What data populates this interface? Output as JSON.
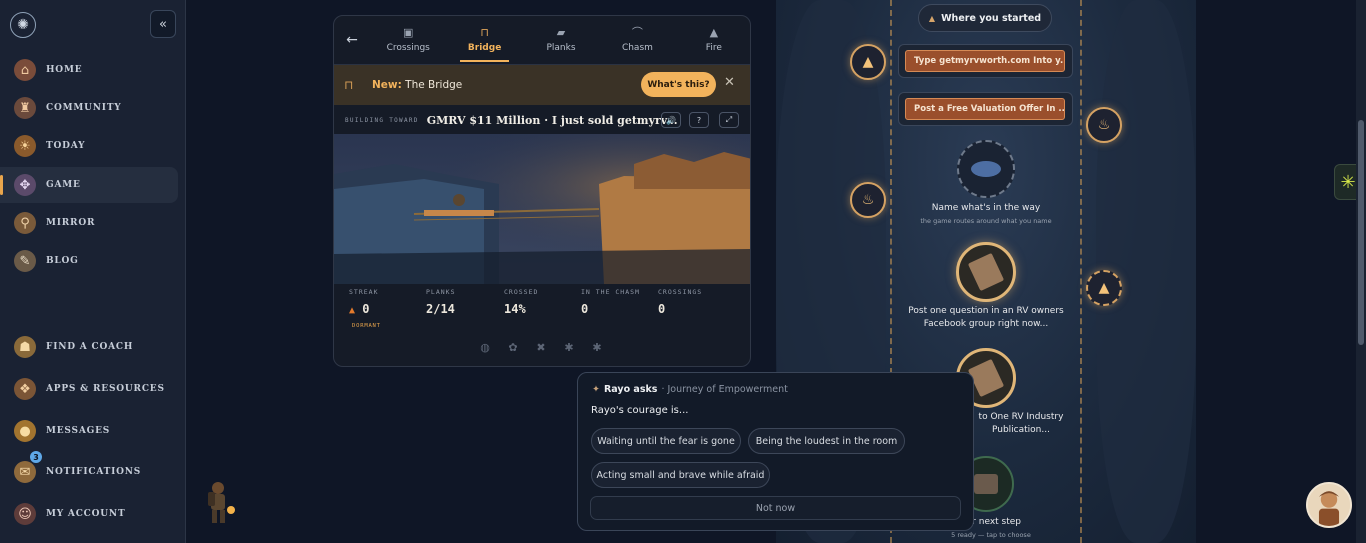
{
  "sidebar": {
    "collapse_icon": "«",
    "items": [
      {
        "label": "HOME",
        "icon": "home-icon"
      },
      {
        "label": "COMMUNITY",
        "icon": "community-icon"
      },
      {
        "label": "TODAY",
        "icon": "today-icon"
      },
      {
        "label": "GAME",
        "icon": "game-icon",
        "active": true
      },
      {
        "label": "MIRROR",
        "icon": "mirror-icon"
      },
      {
        "label": "BLOG",
        "icon": "blog-icon"
      },
      {
        "label": "FIND A COACH",
        "icon": "coach-icon"
      },
      {
        "label": "APPS & RESOURCES",
        "icon": "apps-icon"
      },
      {
        "label": "MESSAGES",
        "icon": "messages-icon"
      },
      {
        "label": "NOTIFICATIONS",
        "icon": "notifications-icon",
        "badge": "3"
      },
      {
        "label": "MY ACCOUNT",
        "icon": "account-icon"
      }
    ]
  },
  "game": {
    "back_icon": "←",
    "tabs": [
      {
        "label": "Crossings"
      },
      {
        "label": "Bridge",
        "active": true
      },
      {
        "label": "Planks"
      },
      {
        "label": "Chasm"
      },
      {
        "label": "Fire"
      }
    ],
    "new_prefix": "New:",
    "new_title": "The Bridge",
    "whats_this": "What's this?",
    "close_icon": "✕",
    "building_label": "BUILDING TOWARD",
    "goal": "GMRV $11 Million · I just sold getmyrv...",
    "controls": [
      "🔊",
      "?",
      "⤢"
    ],
    "stats": {
      "streak_label": "STREAK",
      "streak_value": "0",
      "planks_label": "PLANKS",
      "planks_value": "2/14",
      "crossed_label": "CROSSED",
      "crossed_value": "14%",
      "chasm_label": "IN THE CHASM",
      "chasm_value": "0",
      "crossings_label": "CROSSINGS",
      "crossings_value": "0",
      "dormant": "DORMANT"
    }
  },
  "map": {
    "started": "Where you started",
    "plank1": "Type getmyrvworth.com Into y...",
    "plank2": "Post a Free Valuation Offer In ...",
    "node1_title": "Name what's in the way",
    "node1_sub": "the game routes around what you name",
    "node2_title": "Post one question in an RV owners",
    "node2_title2": "Facebook group right now...",
    "node3_title": "to One RV Industry",
    "node3_title2": "Publication...",
    "node4_title": "our next step",
    "node4_sub": "5 ready — tap to choose"
  },
  "popup": {
    "asker": "Rayo asks",
    "journey": "· Journey of Empowerment",
    "question": "Rayo's courage is...",
    "options": [
      "Waiting until the fear is gone",
      "Being the loudest in the room",
      "Acting small and brave while afraid"
    ],
    "not_now": "Not now"
  },
  "help_icon": "✳",
  "colors": {
    "accent": "#f2b35c",
    "plank": "#9a4f2c",
    "sidebar": "#1a2233"
  }
}
